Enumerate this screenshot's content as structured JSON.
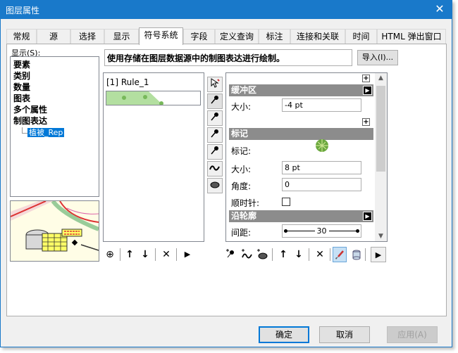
{
  "window": {
    "title": "图层属性",
    "close_glyph": "✕"
  },
  "tabs": [
    {
      "label": "常规"
    },
    {
      "label": "源"
    },
    {
      "label": "选择"
    },
    {
      "label": "显示"
    },
    {
      "label": "符号系统"
    },
    {
      "label": "字段"
    },
    {
      "label": "定义查询"
    },
    {
      "label": "标注"
    },
    {
      "label": "连接和关联"
    },
    {
      "label": "时间"
    },
    {
      "label": "HTML 弹出窗口"
    }
  ],
  "active_tab": "符号系统",
  "show": {
    "label": "显示(S):",
    "items": [
      "要素",
      "类别",
      "数量",
      "图表",
      "多个属性",
      "制图表达"
    ],
    "sub_item": "植被_Rep"
  },
  "description": "使用存储在图层数据源中的制图表达进行绘制。",
  "import_button": "导入(I)...",
  "rules": {
    "label": "[1] Rule_1"
  },
  "left_tools": {
    "add": "⊕",
    "up": "↑",
    "down": "↓",
    "remove": "✕",
    "more": "▶"
  },
  "properties": {
    "buffer": {
      "header": "缓冲区",
      "size_label": "大小:",
      "size_value": "-4 pt"
    },
    "marker": {
      "header": "标记",
      "marker_label": "标记:",
      "size_label": "大小:",
      "size_value": "8 pt",
      "angle_label": "角度:",
      "angle_value": "0",
      "clockwise_label": "顺时针:"
    },
    "along_line": {
      "header": "沿轮廓",
      "spacing_label": "间距:",
      "spacing_value": "30"
    }
  },
  "right_tools": {
    "more": "▶"
  },
  "buttons": {
    "ok": "确定",
    "cancel": "取消",
    "apply": "应用(A)"
  },
  "colors": {
    "title_bar": "#1979ca",
    "selection": "#0078d7",
    "section_header": "#8c8c8c",
    "swatch_fill": "#b3dfa0"
  }
}
